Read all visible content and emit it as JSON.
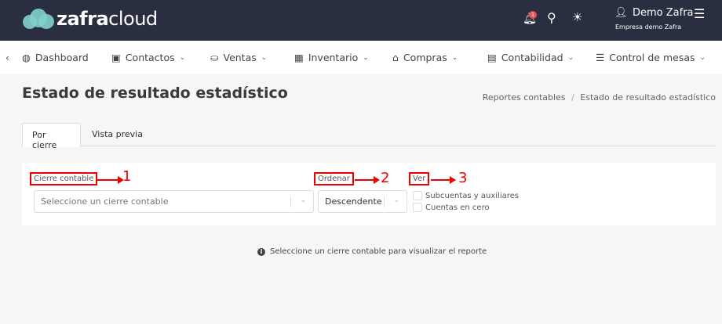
{
  "brand": {
    "name_bold": "zafra",
    "name_light": "cloud",
    "color": "#7fd1cc"
  },
  "header": {
    "notification_count": "1",
    "user_name": "Demo Zafra",
    "company": "Empresa demo Zafra",
    "bg": "#292e40"
  },
  "nav": {
    "items": [
      {
        "label": "Dashboard",
        "icon": "dashboard-icon"
      },
      {
        "label": "Contactos",
        "icon": "contact-card-icon"
      },
      {
        "label": "Ventas",
        "icon": "hand-money-icon"
      },
      {
        "label": "Inventario",
        "icon": "boxes-icon"
      },
      {
        "label": "Compras",
        "icon": "store-icon"
      },
      {
        "label": "Contabilidad",
        "icon": "calculator-icon"
      },
      {
        "label": "Control de mesas",
        "icon": "burger-icon"
      }
    ]
  },
  "page": {
    "title": "Estado de resultado estadístico",
    "breadcrumb": [
      "Reportes contables",
      "/",
      "Estado de resultado estadístico"
    ]
  },
  "tabs": [
    {
      "label": "Por cierre",
      "active": true
    },
    {
      "label": "Vista previa",
      "active": false
    }
  ],
  "form": {
    "cierre_label": "Cierre contable",
    "cierre_placeholder": "Seleccione un cierre contable",
    "ordenar_label": "Ordenar",
    "ordenar_value": "Descendente",
    "ver_label": "Ver",
    "checkboxes": [
      {
        "label": "Subcuentas y auxiliares",
        "checked": false
      },
      {
        "label": "Cuentas en cero",
        "checked": false
      }
    ]
  },
  "annotations": [
    "1",
    "2",
    "3"
  ],
  "info_message": "Seleccione un cierre contable para visualizar el reporte"
}
